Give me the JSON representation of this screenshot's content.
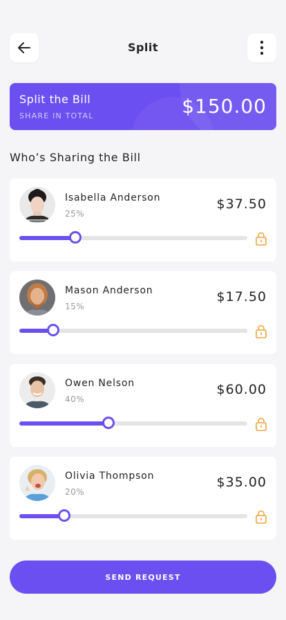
{
  "header": {
    "title": "Split",
    "back_icon": "arrow-left-icon",
    "menu_icon": "more-vertical-icon"
  },
  "summary": {
    "title": "Split the Bill",
    "subtitle": "SHARE IN TOTAL",
    "amount": "$150.00"
  },
  "section_title": "Who’s Sharing the Bill",
  "people": [
    {
      "name": "Isabella Anderson",
      "percent_label": "25%",
      "share": 0.25,
      "amount": "$37.50"
    },
    {
      "name": "Mason Anderson",
      "percent_label": "15%",
      "share": 0.15,
      "amount": "$17.50"
    },
    {
      "name": "Owen Nelson",
      "percent_label": "40%",
      "share": 0.4,
      "amount": "$60.00"
    },
    {
      "name": "Olivia Thompson",
      "percent_label": "20%",
      "share": 0.2,
      "amount": "$35.00"
    }
  ],
  "actions": {
    "send_label": "SEND REQUEST"
  },
  "colors": {
    "accent": "#6c4ff0",
    "lock": "#f0a23a",
    "background": "#f5f5f7"
  }
}
